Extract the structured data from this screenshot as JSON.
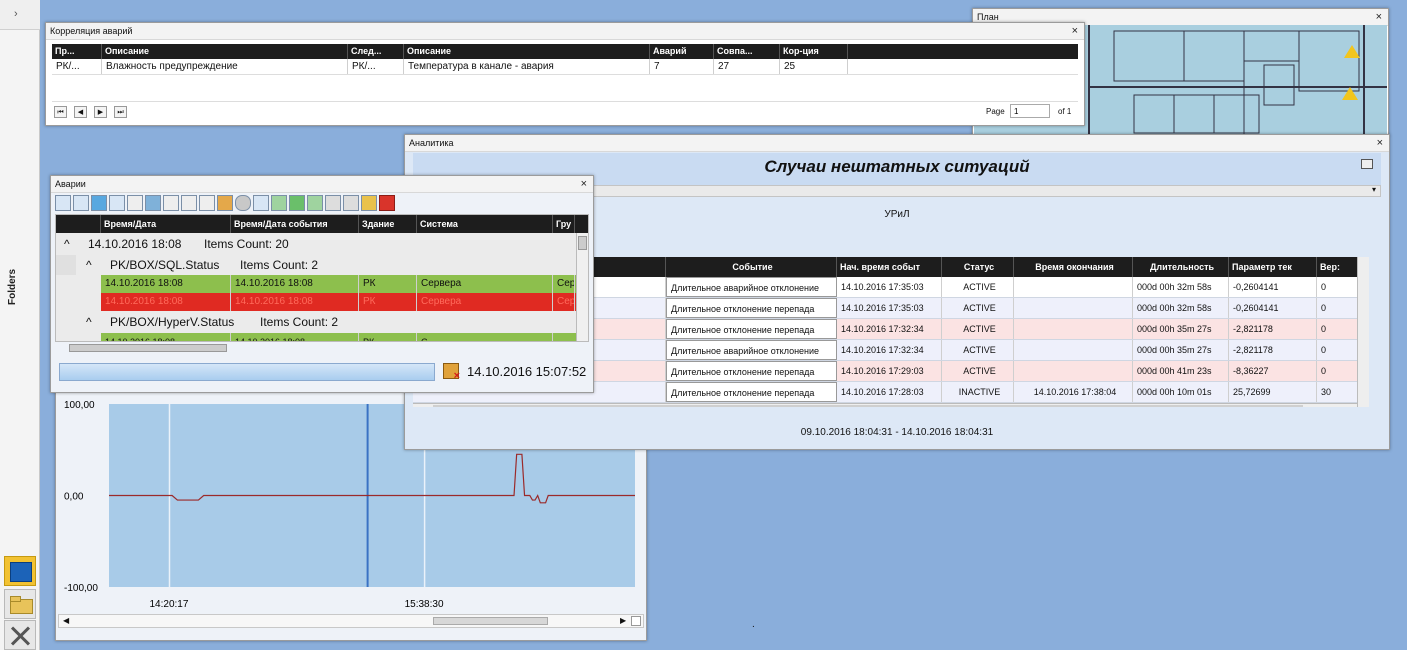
{
  "rail": {
    "chevron": "›",
    "folders_label": "Folders",
    "icons": [
      "blue-square-icon",
      "folder-icon",
      "tools-icon"
    ]
  },
  "correlation": {
    "title": "Корреляция аварий",
    "columns": [
      "Пр...",
      "Описание",
      "След...",
      "Описание",
      "Аварий",
      "Совпа...",
      "Кор-ция"
    ],
    "row": [
      "РК/...",
      "Влажность предупреждение",
      "РК/...",
      "Температура в канале - авария",
      "7",
      "27",
      "25"
    ],
    "pager": {
      "page_label": "Page",
      "page_value": "1",
      "of_label": "of 1",
      "buttons": [
        "⏮",
        "◀",
        "▶",
        "⏭"
      ]
    }
  },
  "plan": {
    "title": "План",
    "warn": "!"
  },
  "analytics": {
    "title": "Аналитика",
    "heading": "Случаи нештатных ситуаций",
    "subtitle": "УРиЛ",
    "columns": [
      "",
      "Событие",
      "Нач. время событ",
      "Статус",
      "Время окончания",
      "Длительность",
      "Параметр тек",
      "Вер:"
    ],
    "rows": [
      {
        "event": "Длительное аварийное отклонение",
        "start": "14.10.2016 17:35:03",
        "status": "ACTIVE",
        "end": "",
        "dur": "000d 00h 32m 58s",
        "param": "-0,2604141",
        "ver": "0",
        "color": "#ffffff"
      },
      {
        "event": "Длительное отклонение перепада",
        "start": "14.10.2016 17:35:03",
        "status": "ACTIVE",
        "end": "",
        "dur": "000d 00h 32m 58s",
        "param": "-0,2604141",
        "ver": "0",
        "color": "#eef0fb"
      },
      {
        "event": "Длительное отклонение перепада",
        "start": "14.10.2016 17:32:34",
        "status": "ACTIVE",
        "end": "",
        "dur": "000d 00h 35m 27s",
        "param": "-2,821178",
        "ver": "0",
        "color": "#fbe3e3"
      },
      {
        "event": "Длительное аварийное отклонение",
        "start": "14.10.2016 17:32:34",
        "status": "ACTIVE",
        "end": "",
        "dur": "000d 00h 35m 27s",
        "param": "-2,821178",
        "ver": "0",
        "color": "#eef0fb"
      },
      {
        "event": "Длительное отклонение перепада",
        "start": "14.10.2016 17:29:03",
        "status": "ACTIVE",
        "end": "",
        "dur": "000d 00h 41m 23s",
        "param": "-8,36227",
        "ver": "0",
        "color": "#fbe3e3"
      },
      {
        "event": "Длительное отклонение перепада",
        "start": "14.10.2016 17:28:03",
        "status": "INACTIVE",
        "end": "14.10.2016 17:38:04",
        "dur": "000d 00h 10m 01s",
        "param": "25,72699",
        "ver": "30",
        "color": "#eef0fb"
      }
    ],
    "period": "09.10.2016 18:04:31 - 14.10.2016 18:04:31"
  },
  "alarms": {
    "title": "Аварии",
    "columns": [
      "Время/Дата",
      "Время/Дата события",
      "Здание",
      "Система",
      "Гру"
    ],
    "group1": {
      "label": "14.10.2016 18:08",
      "count": "Items Count: 20"
    },
    "group2": {
      "label": "PK/BOX/SQL.Status",
      "count": "Items Count: 2"
    },
    "rowGreen": [
      "14.10.2016 18:08",
      "14.10.2016 18:08",
      "РК",
      "Сервера",
      "Сер"
    ],
    "rowRed": [
      "14.10.2016 18:08",
      "14.10.2016 18:08",
      "РК",
      "Сервера",
      "Сер"
    ],
    "group3": {
      "label": "PK/BOX/HyperV.Status",
      "count": "Items Count: 2"
    },
    "rowPartial": [
      "14.10.2016 18:08",
      "14.10.2016 18:08",
      "РК",
      "С..."
    ],
    "timestamp": "14.10.2016 15:07:52"
  },
  "trend": {
    "chart_data": {
      "type": "line",
      "y_ticks": [
        "100,00",
        "0,00",
        "-100,00"
      ],
      "x_ticks": [
        "14:20:17",
        "15:38:30"
      ],
      "ylim": [
        -100,
        100
      ],
      "series": [
        {
          "values_description_free": true,
          "points": [
            [
              0,
              0
            ],
            [
              0.12,
              0
            ],
            [
              0.13,
              -5
            ],
            [
              0.17,
              -5
            ],
            [
              0.18,
              0
            ],
            [
              0.77,
              0
            ],
            [
              0.775,
              45
            ],
            [
              0.785,
              45
            ],
            [
              0.79,
              0
            ],
            [
              0.8,
              0
            ],
            [
              0.805,
              -5
            ],
            [
              0.81,
              -5
            ],
            [
              0.815,
              0
            ],
            [
              0.82,
              -8
            ],
            [
              0.83,
              -8
            ],
            [
              0.835,
              0
            ],
            [
              1,
              0
            ]
          ],
          "color": "#9b2a2a"
        }
      ]
    },
    "scroll_left": "◀",
    "scroll_right": "▶"
  },
  "dot": "."
}
